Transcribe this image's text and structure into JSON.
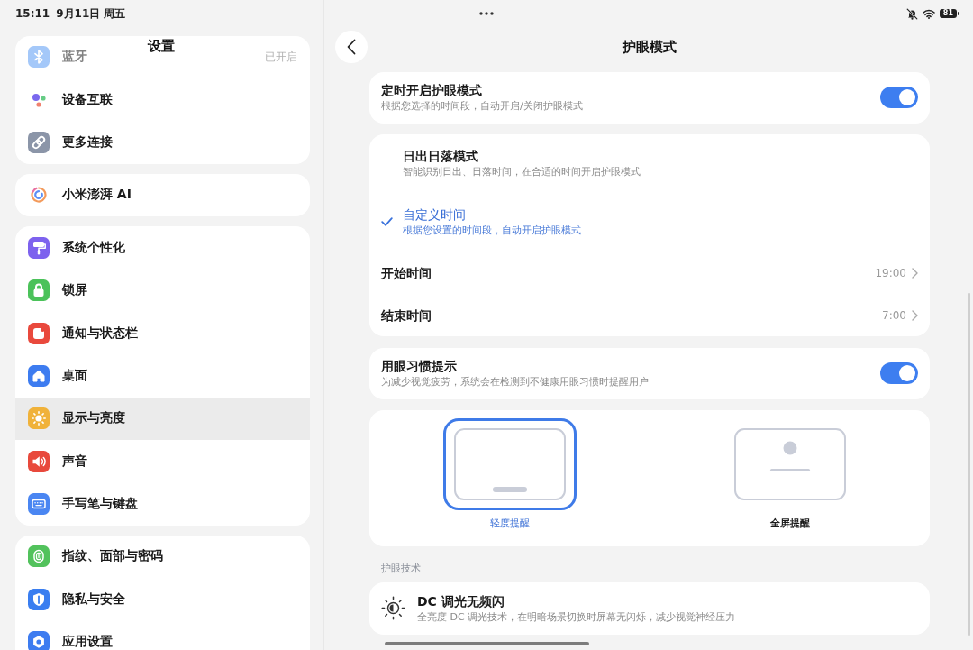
{
  "status_bar": {
    "time": "15:11",
    "date": "9月11日 周五",
    "battery": "81"
  },
  "sidebar": {
    "title": "设置",
    "groups": [
      {
        "items": [
          {
            "label": "蓝牙",
            "value": "已开启",
            "faded": true,
            "selected": false
          },
          {
            "label": "设备互联",
            "faded": false,
            "selected": false
          },
          {
            "label": "更多连接",
            "faded": false,
            "selected": false
          }
        ]
      },
      {
        "items": [
          {
            "label": "小米澎湃 AI",
            "faded": false,
            "selected": false
          }
        ]
      },
      {
        "items": [
          {
            "label": "系统个性化",
            "faded": false,
            "selected": false
          },
          {
            "label": "锁屏",
            "faded": false,
            "selected": false
          },
          {
            "label": "通知与状态栏",
            "faded": false,
            "selected": false
          },
          {
            "label": "桌面",
            "faded": false,
            "selected": false
          },
          {
            "label": "显示与亮度",
            "faded": false,
            "selected": true
          },
          {
            "label": "声音",
            "faded": false,
            "selected": false
          },
          {
            "label": "手写笔与键盘",
            "faded": false,
            "selected": false
          }
        ]
      },
      {
        "items": [
          {
            "label": "指纹、面部与密码",
            "faded": false,
            "selected": false
          },
          {
            "label": "隐私与安全",
            "faded": false,
            "selected": false
          },
          {
            "label": "应用设置",
            "faded": false,
            "selected": false
          }
        ]
      }
    ]
  },
  "detail": {
    "title": "护眼模式",
    "schedule": {
      "title": "定时开启护眼模式",
      "description": "根据您选择的时间段，自动开启/关闭护眼模式",
      "on": true
    },
    "modes": [
      {
        "title": "日出日落模式",
        "description": "智能识别日出、日落时间，在合适的时间开启护眼模式",
        "selected": false
      },
      {
        "title": "自定义时间",
        "description": "根据您设置的时间段，自动开启护眼模式",
        "selected": true
      }
    ],
    "times": [
      {
        "label": "开始时间",
        "value": "19:00"
      },
      {
        "label": "结束时间",
        "value": "7:00"
      }
    ],
    "habit_reminder": {
      "title": "用眼习惯提示",
      "description": "为减少视觉疲劳，系统会在检测到不健康用眼习惯时提醒用户",
      "on": true
    },
    "reminder_styles": [
      {
        "label": "轻度提醒",
        "kind": "banner",
        "selected": true
      },
      {
        "label": "全屏提醒",
        "kind": "fullscreen",
        "selected": false
      }
    ],
    "tech_section": {
      "label": "护眼技术",
      "items": [
        {
          "title": "DC 调光无频闪",
          "description": "全亮度 DC 调光技术，在明暗场景切换时屏幕无闪烁，减少视觉神经压力"
        }
      ]
    }
  }
}
